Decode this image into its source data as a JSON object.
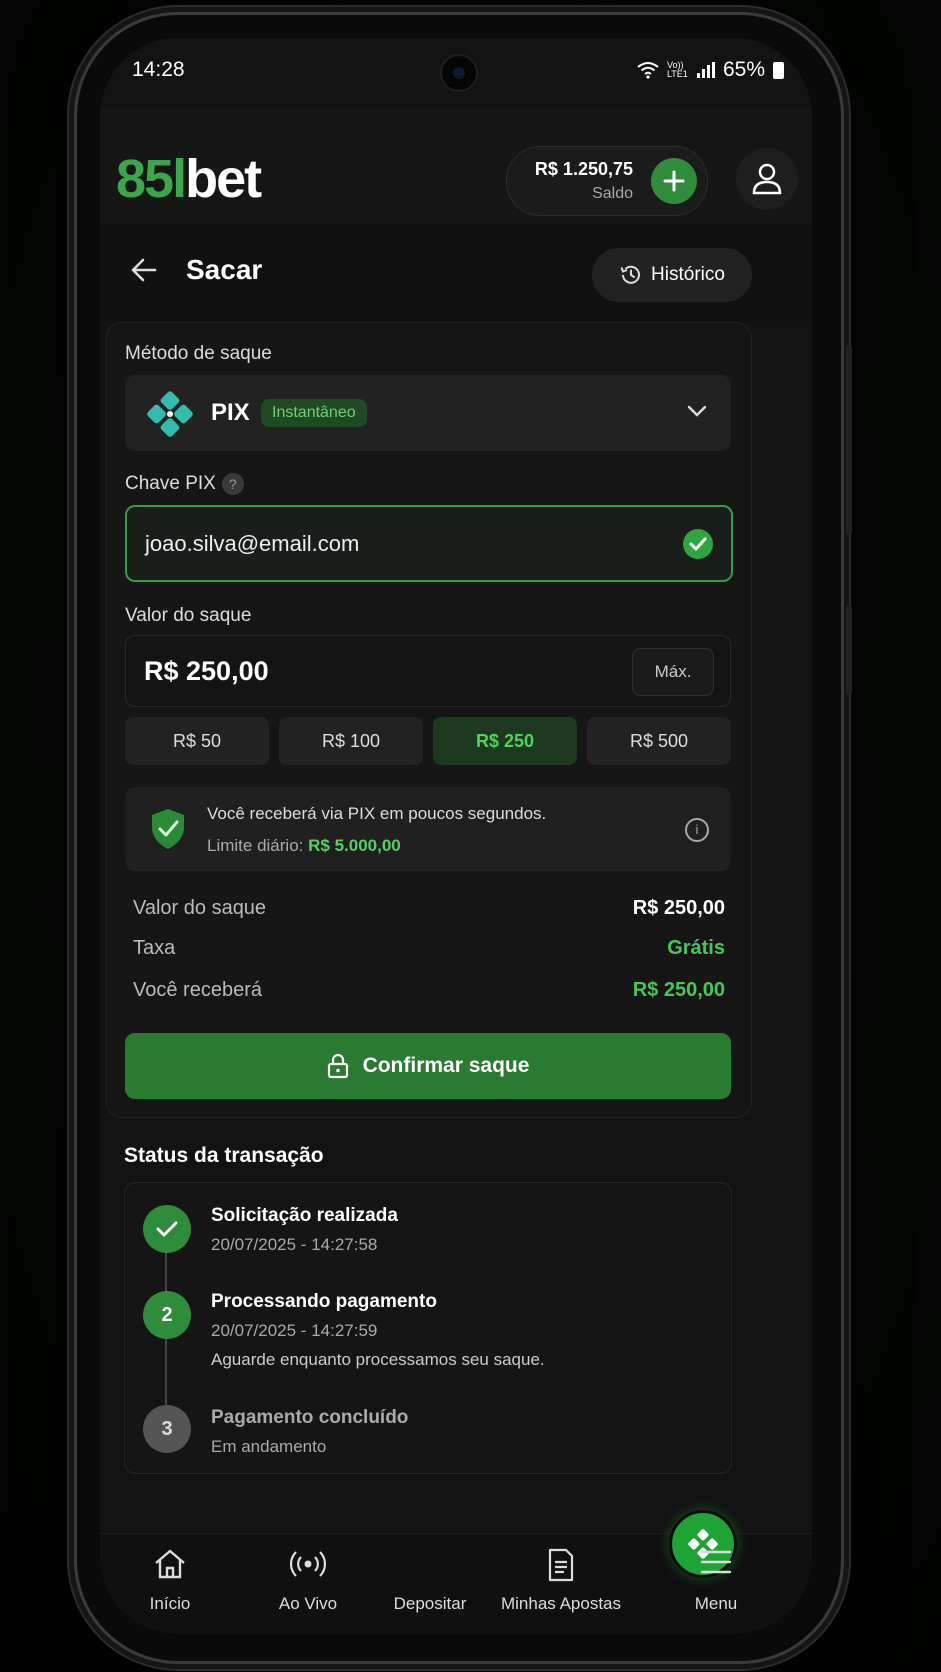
{
  "status_bar": {
    "time": "14:28",
    "network": "Vo)) LTE1",
    "battery": "65%"
  },
  "header": {
    "logo_prefix": "85l",
    "logo_suffix": "bet",
    "balance_amount": "R$ 1.250,75",
    "balance_label": "Saldo"
  },
  "page": {
    "title": "Sacar",
    "history_label": "Histórico"
  },
  "method": {
    "label": "Método de saque",
    "name": "PIX",
    "badge": "Instantâneo"
  },
  "pix_key": {
    "label": "Chave PIX",
    "help": "?",
    "value": "joao.silva@email.com"
  },
  "amount": {
    "label": "Valor do saque",
    "value": "R$ 250,00",
    "max_label": "Máx.",
    "quick": [
      "R$ 50",
      "R$ 100",
      "R$ 250",
      "R$ 500"
    ],
    "selected_quick": "R$ 250"
  },
  "info": {
    "line1": "Você receberá via PIX em poucos segundos.",
    "limit_label": "Limite diário:",
    "limit_value": "R$ 5.000,00",
    "info_icon": "i"
  },
  "summary": {
    "rows": [
      {
        "label": "Valor do saque",
        "value": "R$ 250,00"
      },
      {
        "label": "Taxa",
        "value": "Grátis"
      },
      {
        "label": "Você receberá",
        "value": "R$ 250,00"
      }
    ]
  },
  "confirm_label": "Confirmar saque",
  "status": {
    "title": "Status da transação",
    "steps": [
      {
        "marker": "✓",
        "title": "Solicitação realizada",
        "time": "20/07/2025 - 14:27:58"
      },
      {
        "marker": "2",
        "title": "Processando pagamento",
        "time": "20/07/2025 - 14:27:59",
        "note": "Aguarde enquanto processamos seu saque."
      },
      {
        "marker": "3",
        "title": "Pagamento concluído",
        "time": "Em andamento"
      }
    ]
  },
  "nav": {
    "items": [
      {
        "label": "Início",
        "icon": "home-icon"
      },
      {
        "label": "Ao Vivo",
        "icon": "live-icon"
      },
      {
        "label": "Depositar",
        "icon": "deposit-icon"
      },
      {
        "label": "Minhas Apostas",
        "icon": "bets-icon"
      },
      {
        "label": "Menu",
        "icon": "menu-icon"
      }
    ]
  },
  "colors": {
    "accent": "#2f8c3a",
    "accent_bright": "#48c656",
    "background": "#131313"
  }
}
